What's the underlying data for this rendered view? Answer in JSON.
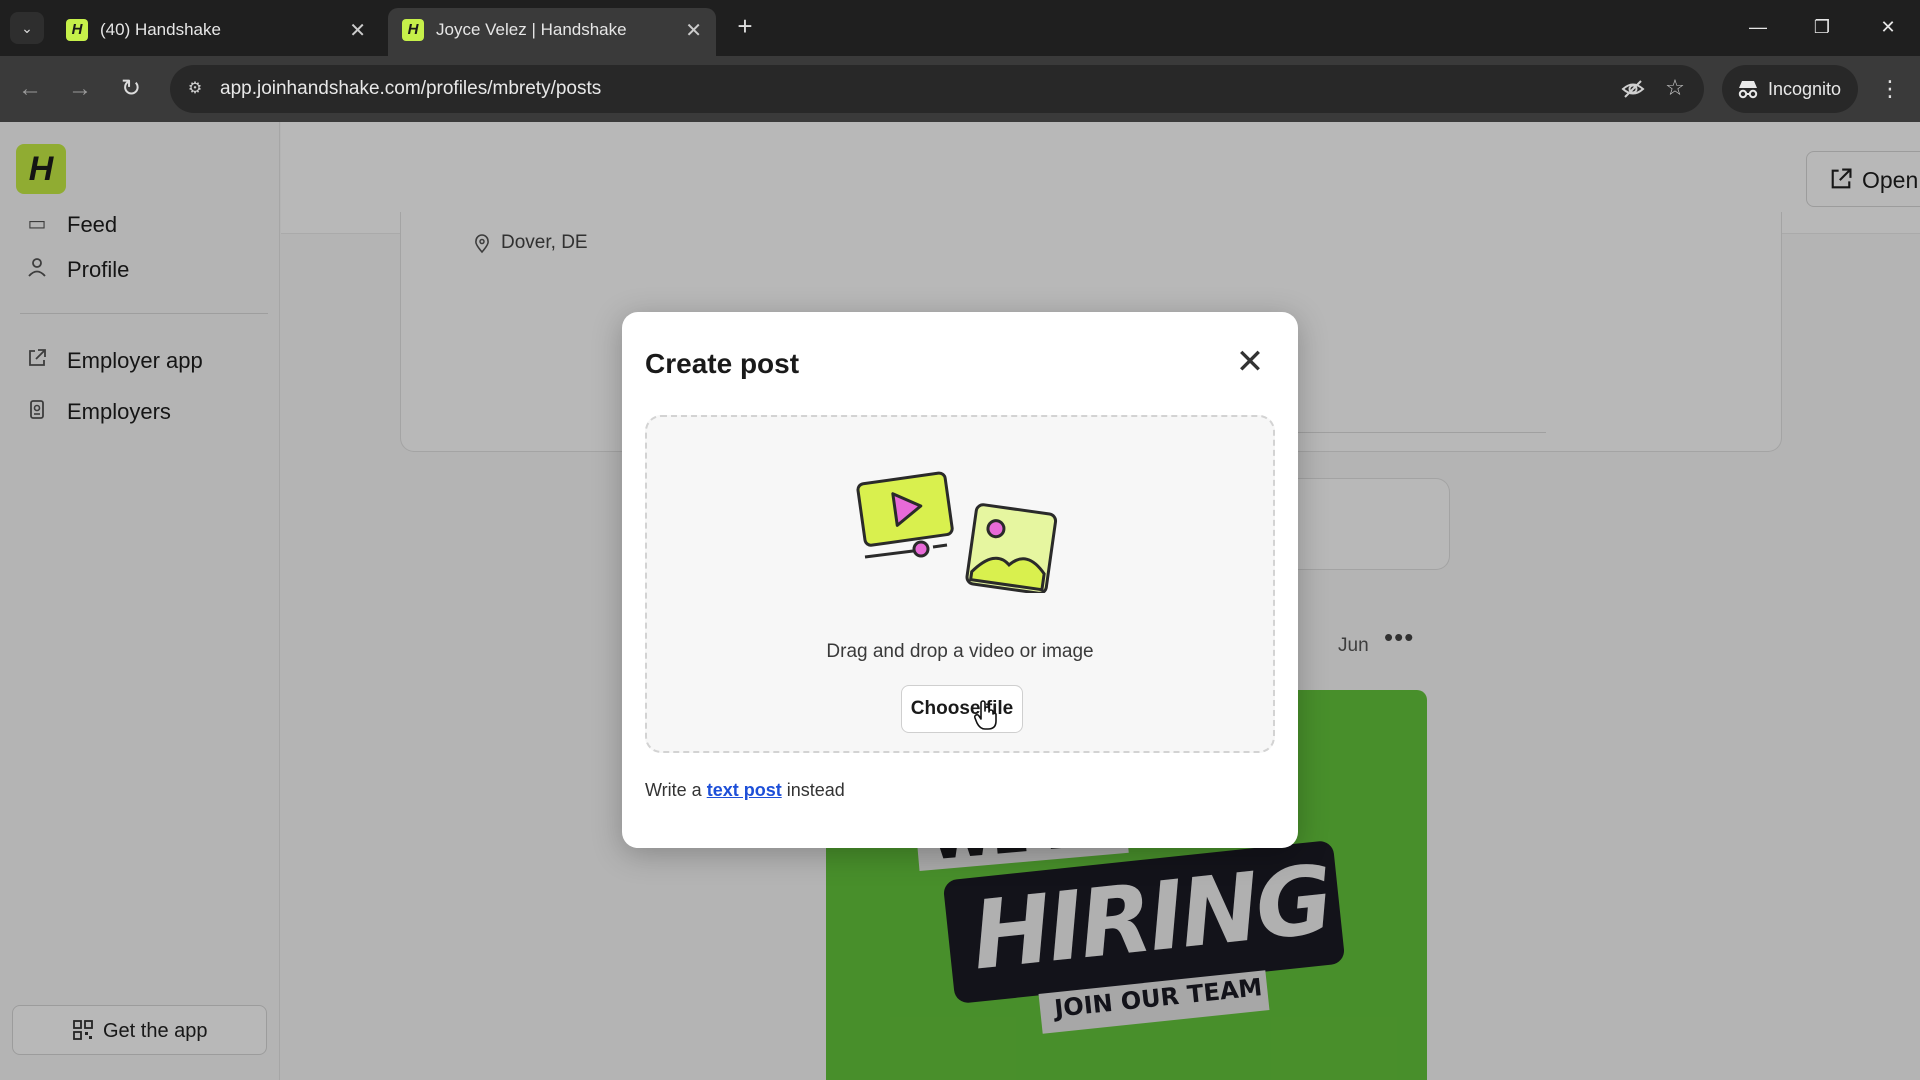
{
  "browser": {
    "tabs": [
      {
        "favicon": "H",
        "title": "(40) Handshake",
        "active": false
      },
      {
        "favicon": "H",
        "title": "Joyce Velez | Handshake",
        "active": true
      }
    ],
    "url": "app.joinhandshake.com/profiles/mbrety/posts",
    "incognito_label": "Incognito"
  },
  "app": {
    "logo": "H",
    "sidebar": {
      "items": [
        {
          "label": "Feed",
          "icon": "feed-icon"
        },
        {
          "label": "Profile",
          "icon": "person-icon"
        },
        {
          "label": "Employer app",
          "icon": "external-link-icon"
        },
        {
          "label": "Employers",
          "icon": "badge-icon"
        }
      ],
      "get_app_label": "Get the app"
    },
    "header": {
      "open_employer_label": "Open employer app"
    },
    "profile": {
      "location": "Dover, DE"
    },
    "post": {
      "date": "Jun",
      "image_text": {
        "line1": "WE'RE",
        "line2": "HIRING",
        "line3": "JOIN OUR TEAM"
      }
    }
  },
  "modal": {
    "title": "Create post",
    "drop_text": "Drag and drop a video or image",
    "choose_file_label": "Choose file",
    "text_post_prefix": "Write a",
    "text_post_link": "text post",
    "text_post_suffix": "instead"
  },
  "colors": {
    "brand": "#c8ef46",
    "link": "#1d4fd8",
    "hiring_bg": "#65c63c"
  }
}
